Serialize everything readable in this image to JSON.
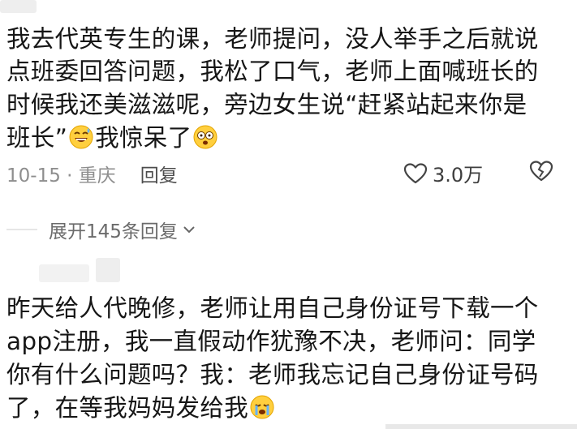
{
  "comment1": {
    "lines": [
      "我去代英专生的课，老师提问，没人举手之后就说",
      "点班委回答问题，我松了口气，老师上面喊班长的",
      "时候我还美滋滋呢，旁边女生说“赶紧站起来你是",
      "班长”",
      "我惊呆了"
    ],
    "emoji_1": "grinning-sweat-emoji",
    "emoji_2": "shocked-face-emoji",
    "date_location": "10-15 · 重庆",
    "reply_label": "回复",
    "likes": "3.0万",
    "like_icon": "heart-outline-icon",
    "dislike_icon": "broken-heart-icon"
  },
  "expand": {
    "label": "展开145条回复",
    "icon": "chevron-down-icon"
  },
  "comment2": {
    "lines": [
      "昨天给人代晚修，老师让用自己身份证号下载一个",
      "app注册，我一直假动作犹豫不决，老师问：同学",
      "你有什么问题吗？我：老师我忘记自己身份证号码",
      "了，在等我妈妈发给我"
    ],
    "emoji": "crying-face-emoji"
  }
}
